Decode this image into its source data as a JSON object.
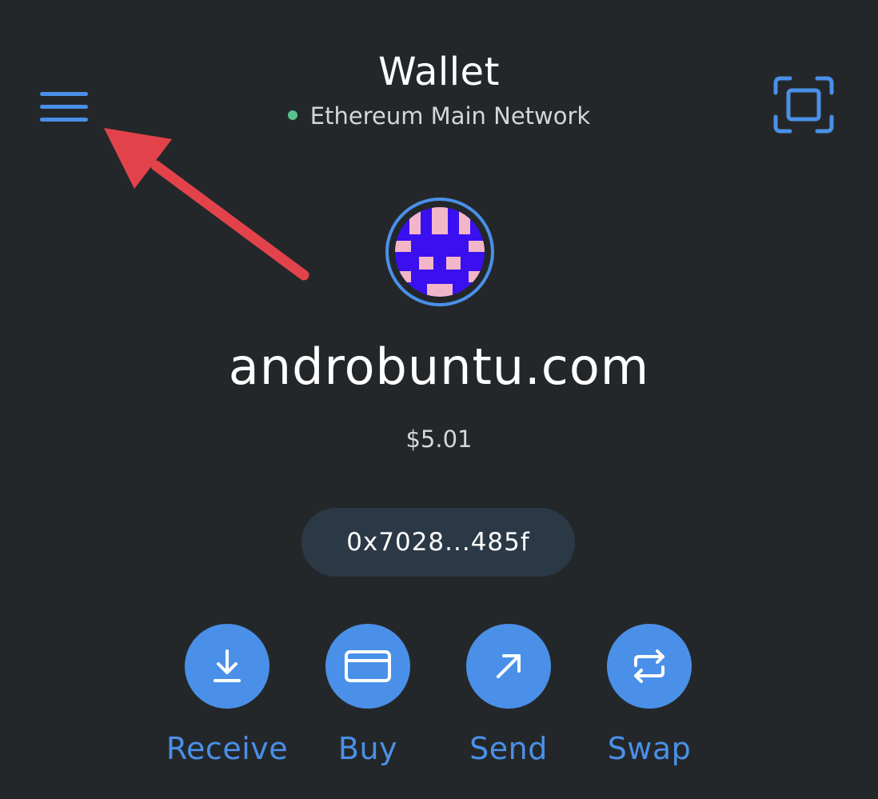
{
  "header": {
    "title": "Wallet",
    "network": "Ethereum Main Network",
    "network_status_color": "#56c48e"
  },
  "account": {
    "name": "androbuntu.com",
    "balance": "$5.01",
    "address": "0x7028...485f"
  },
  "actions": [
    {
      "label": "Receive",
      "icon": "download-icon"
    },
    {
      "label": "Buy",
      "icon": "credit-card-icon"
    },
    {
      "label": "Send",
      "icon": "arrow-up-right-icon"
    },
    {
      "label": "Swap",
      "icon": "swap-arrows-icon"
    }
  ],
  "icons": {
    "menu": "hamburger-menu-icon",
    "scan": "qr-scan-icon"
  },
  "annotation": {
    "type": "red-arrow",
    "points_to": "hamburger-menu-icon",
    "color": "#e2434b"
  },
  "colors": {
    "background": "#24272a",
    "accent": "#4a90e8",
    "pill": "#2b3946",
    "text": "#ffffff"
  }
}
